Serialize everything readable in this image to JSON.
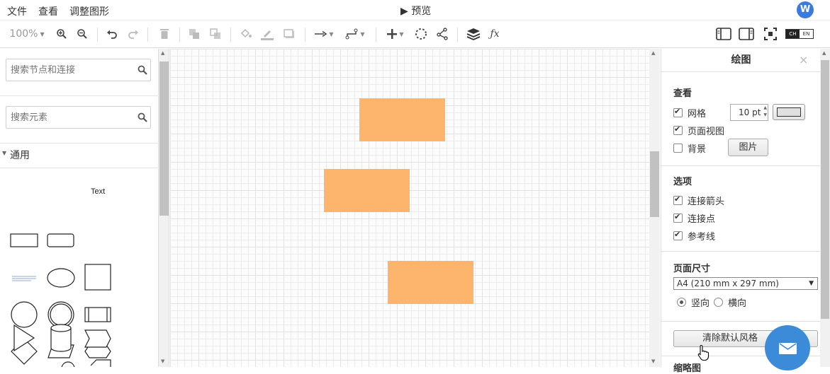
{
  "menubar": {
    "items": [
      "文件",
      "查看",
      "调整图形"
    ],
    "preview_label": "▶ 预览",
    "user_initial": "W"
  },
  "toolbar": {
    "zoom": "100%",
    "switch": {
      "on": "CH",
      "off": "EN"
    }
  },
  "sidebar": {
    "search_nodes_placeholder": "搜索节点和连接",
    "search_shapes_placeholder": "搜索元素",
    "section_general": "通用",
    "shape_text": "Text"
  },
  "panel": {
    "title": "绘图",
    "view": {
      "title": "查看",
      "grid_label": "网格",
      "grid_size": "10 pt",
      "page_view_label": "页面视图",
      "background_label": "背景",
      "image_button": "图片"
    },
    "options": {
      "title": "选项",
      "connection_arrows": "连接箭头",
      "connection_points": "连接点",
      "guides": "参考线"
    },
    "page_size": {
      "title": "页面尺寸",
      "selected": "A4 (210 mm x 297 mm)",
      "portrait": "竖向",
      "landscape": "横向"
    },
    "reset_style_button": "清除默认风格",
    "next_section_title": "缩略图"
  },
  "colors": {
    "shape_fill": "#fdb46c",
    "accent": "#3b7be0"
  }
}
